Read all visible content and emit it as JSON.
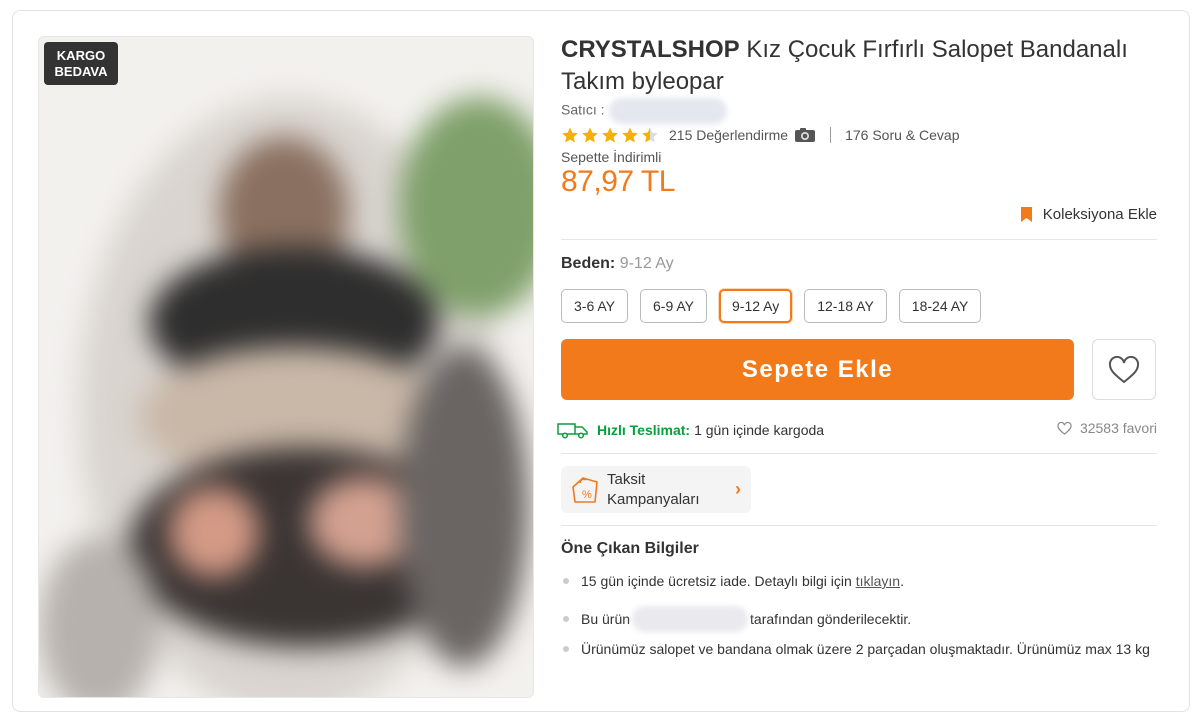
{
  "badge": {
    "line1": "KARGO",
    "line2": "BEDAVA"
  },
  "product": {
    "brand": "CRYSTALSHOP",
    "title": "Kız Çocuk Fırfırlı Salopet Bandanalı Takım byleopar",
    "seller_label": "Satıcı :"
  },
  "rating": {
    "stars": 4.5,
    "reviews": "215 Değerlendirme",
    "qa": "176 Soru & Cevap"
  },
  "price": {
    "discount_label": "Sepette İndirimli",
    "value": "87,97 TL"
  },
  "collection": {
    "label": "Koleksiyona Ekle"
  },
  "size": {
    "label": "Beden:",
    "selected": "9-12 Ay",
    "options": [
      "3-6 AY",
      "6-9 AY",
      "9-12 Ay",
      "12-18 AY",
      "18-24 AY"
    ]
  },
  "cart": {
    "label": "Sepete Ekle"
  },
  "delivery": {
    "fast_label": "Hızlı Teslimat:",
    "text": "1 gün içinde kargoda"
  },
  "favorites": {
    "count": "32583 favori"
  },
  "installment": {
    "line1": "Taksit",
    "line2": "Kampanyaları",
    "arrow": "›"
  },
  "highlights": {
    "title": "Öne Çıkan Bilgiler",
    "item1_text": "15 gün içinde ücretsiz iade. Detaylı bilgi için",
    "item1_link": "tıklayın",
    "item1_end": ".",
    "item2_pre": "Bu ürün",
    "item2_post": "tarafından gönderilecektir.",
    "item3": "Ürünümüz salopet ve bandana olmak üzere 2 parçadan oluşmaktadır. Ürünümüz max 13 kg"
  },
  "colors": {
    "accent": "#f27a1a",
    "success": "#0b9e3b",
    "badge_bg": "#333333"
  }
}
